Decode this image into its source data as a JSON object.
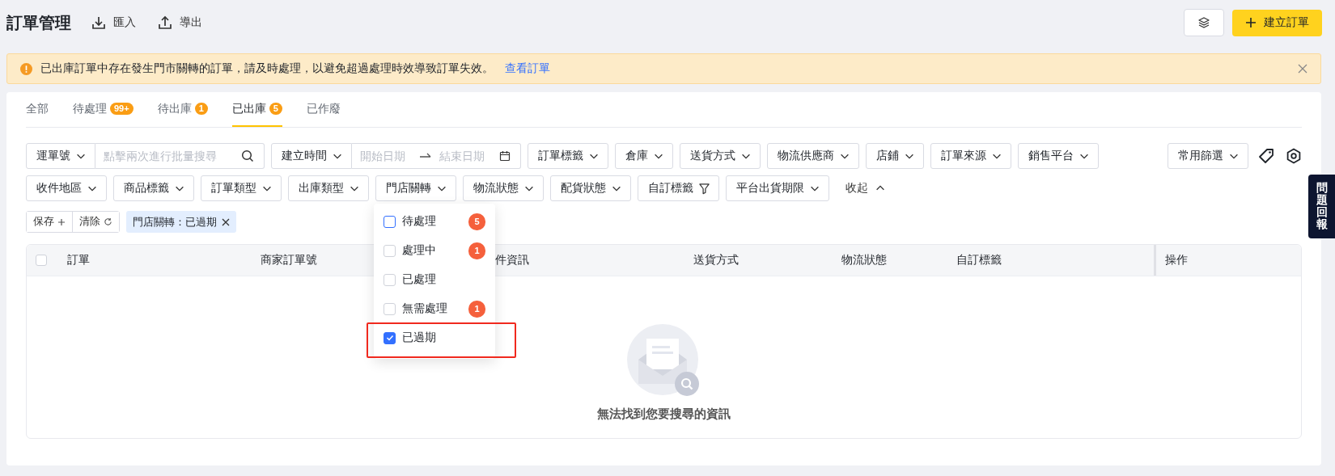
{
  "page": {
    "title": "訂單管理",
    "actions": [
      {
        "label": "匯入",
        "kind": "import"
      },
      {
        "label": "導出",
        "kind": "export"
      }
    ],
    "create_button": "建立訂單"
  },
  "alert": {
    "message": "已出庫訂單中存在發生門市關轉的訂單，請及時處理，以避免超過處理時效導致訂單失效。",
    "link": "查看訂單"
  },
  "tabs": [
    {
      "label": "全部",
      "selected": false
    },
    {
      "label": "待處理",
      "badge": "99+",
      "selected": false
    },
    {
      "label": "待出庫",
      "badge": "1",
      "selected": false
    },
    {
      "label": "已出庫",
      "badge": "5",
      "selected": true
    },
    {
      "label": "已作廢",
      "selected": false
    }
  ],
  "filters": {
    "search": {
      "field": "運單號",
      "placeholder": "點擊兩次進行批量搜尋"
    },
    "date": {
      "field": "建立時間",
      "start_placeholder": "開始日期",
      "end_placeholder": "結束日期"
    },
    "row_1": [
      {
        "label": "訂單標籤",
        "kind": "dropdown"
      },
      {
        "label": "倉庫",
        "kind": "dropdown"
      },
      {
        "label": "送貨方式",
        "kind": "dropdown"
      },
      {
        "label": "物流供應商",
        "kind": "dropdown"
      },
      {
        "label": "店鋪",
        "kind": "dropdown"
      },
      {
        "label": "訂單來源",
        "kind": "dropdown"
      },
      {
        "label": "銷售平台",
        "kind": "dropdown"
      }
    ],
    "common": "常用篩選",
    "row_2": [
      {
        "label": "收件地區",
        "kind": "dropdown"
      },
      {
        "label": "商品標籤",
        "kind": "dropdown"
      },
      {
        "label": "訂單類型",
        "kind": "dropdown"
      },
      {
        "label": "出庫類型",
        "kind": "dropdown"
      },
      {
        "label": "門店關轉",
        "kind": "dropdown"
      },
      {
        "label": "物流狀態",
        "kind": "dropdown"
      },
      {
        "label": "配貨狀態",
        "kind": "dropdown"
      },
      {
        "label": "自訂標籤",
        "kind": "filter"
      },
      {
        "label": "平台出貨期限",
        "kind": "dropdown"
      }
    ],
    "collapse": "收起"
  },
  "saved": {
    "save": "保存",
    "clear": "清除",
    "chip": "門店關轉：已過期"
  },
  "dropdown": {
    "options": [
      {
        "label": "待處理",
        "count": "5",
        "checked": false,
        "highlighted": false
      },
      {
        "label": "處理中",
        "count": "1",
        "checked": false,
        "highlighted": false
      },
      {
        "label": "已處理",
        "checked": false,
        "highlighted": false
      },
      {
        "label": "無需處理",
        "count": "1",
        "checked": false,
        "highlighted": false
      },
      {
        "label": "已過期",
        "checked": true,
        "highlighted": true
      }
    ]
  },
  "table": {
    "select_all_checked": false,
    "columns": [
      "訂單",
      "商家訂單號",
      "件資訊",
      "送貨方式",
      "物流狀態",
      "自訂標籤",
      "操作"
    ],
    "empty_message": "無法找到您要搜尋的資訊"
  },
  "feedback": "問題回報"
}
